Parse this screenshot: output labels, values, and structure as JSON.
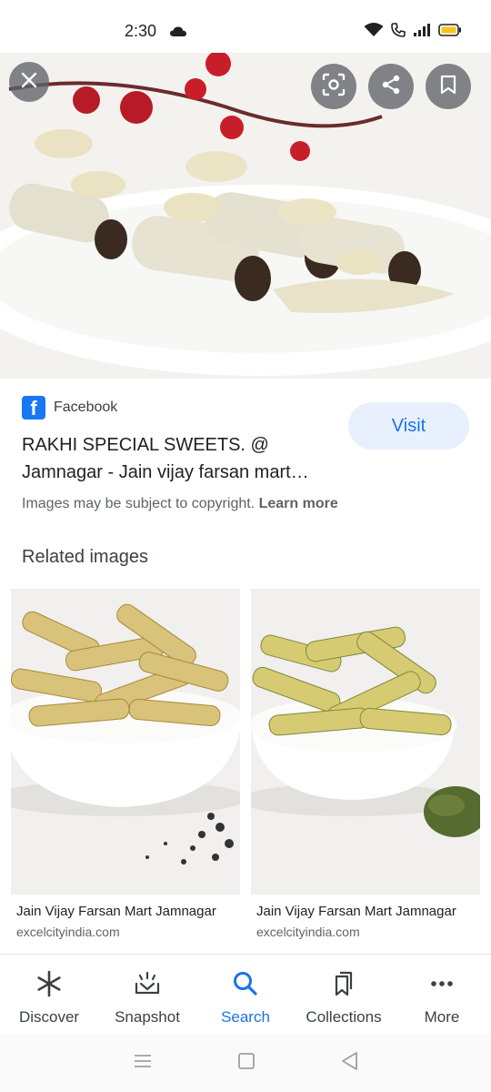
{
  "status": {
    "time": "2:30"
  },
  "hero": {
    "alt": "Rakhi special sweets"
  },
  "source": {
    "name": "Facebook",
    "title": "RAKHI SPECIAL SWEETS. @ Jamnagar - Jain vijay farsan mart…",
    "visit_label": "Visit"
  },
  "copyright": {
    "text": "Images may be subject to copyright.",
    "link": "Learn more"
  },
  "related": {
    "heading": "Related images",
    "items": [
      {
        "title": "Jain Vijay Farsan Mart Jamnagar",
        "site": "excelcityindia.com"
      },
      {
        "title": "Jain Vijay Farsan Mart Jamnagar",
        "site": "excelcityindia.com"
      }
    ]
  },
  "bottom_nav": {
    "items": [
      {
        "label": "Discover",
        "icon": "asterisk-icon"
      },
      {
        "label": "Snapshot",
        "icon": "snapshot-icon"
      },
      {
        "label": "Search",
        "icon": "search-icon"
      },
      {
        "label": "Collections",
        "icon": "collections-icon"
      },
      {
        "label": "More",
        "icon": "more-icon"
      }
    ],
    "active": "Search"
  },
  "colors": {
    "accent": "#1a73e8",
    "visit_bg": "#e8f0fe",
    "facebook": "#1877f2"
  }
}
